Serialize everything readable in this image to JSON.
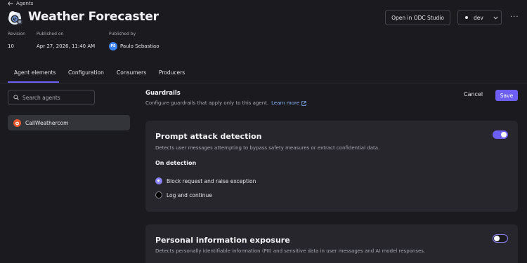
{
  "header": {
    "breadcrumb": "Agents",
    "title": "Weather Forecaster",
    "open_studio_label": "Open in ODC Studio",
    "env_label": "dev",
    "more_label": "···"
  },
  "meta": {
    "revision_label": "Revision",
    "revision_value": "10",
    "published_on_label": "Published on",
    "published_on_value": "Apr 27, 2026, 11:40 AM",
    "published_by_label": "Published by",
    "published_by_initials": "PS",
    "published_by_name": "Paulo Sebastiao"
  },
  "tabs": [
    {
      "label": "Agent elements",
      "active": true
    },
    {
      "label": "Configuration",
      "active": false
    },
    {
      "label": "Consumers",
      "active": false
    },
    {
      "label": "Producers",
      "active": false
    }
  ],
  "sidebar": {
    "search_placeholder": "Search agents",
    "items": [
      {
        "label": "CallWeathercom",
        "selected": true
      }
    ]
  },
  "guardrails": {
    "title": "Guardrails",
    "subtitle": "Configure guardrails that apply only to this agent.",
    "learn_more": "Learn more",
    "cancel_label": "Cancel",
    "save_label": "Save"
  },
  "cards": [
    {
      "title": "Prompt attack detection",
      "description": "Detects user messages attempting to bypass safety measures or extract confidential data.",
      "enabled": true,
      "on_detection_label": "On detection",
      "options": [
        {
          "label": "Block request and raise exception",
          "selected": true
        },
        {
          "label": "Log and continue",
          "selected": false
        }
      ]
    },
    {
      "title": "Personal information exposure",
      "description": "Detects personally identifiable information (PII) and sensitive data in user messages and AI model responses.",
      "enabled": false
    }
  ],
  "colors": {
    "accent": "#6d5ff5",
    "background": "#1b1b1f",
    "card": "#26262c",
    "link": "#8ab4ff"
  }
}
